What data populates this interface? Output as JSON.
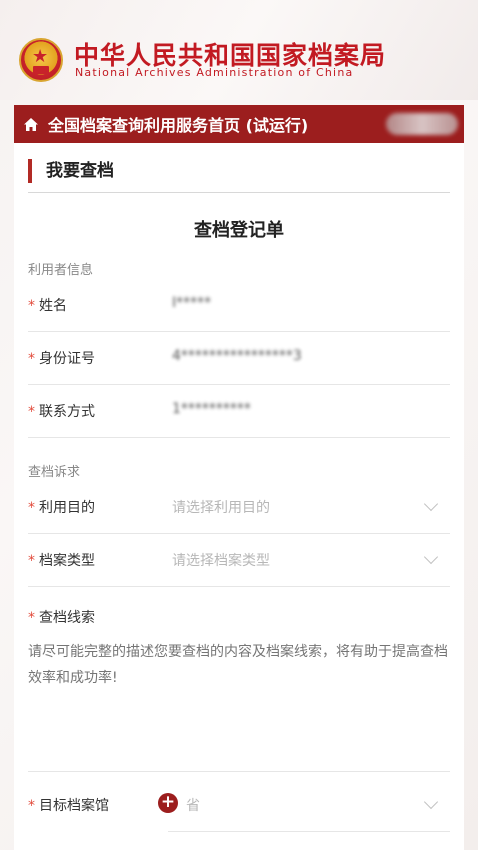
{
  "header": {
    "org_name_cn": "中华人民共和国国家档案局",
    "org_name_en": "National Archives Administration of China"
  },
  "nav": {
    "title": "全国档案查询利用服务首页 (试运行)"
  },
  "section": {
    "title": "我要查档"
  },
  "form": {
    "title": "查档登记单",
    "user_info_label": "利用者信息",
    "name": {
      "label": "姓名",
      "value": "I*****"
    },
    "id_number": {
      "label": "身份证号",
      "value": "4****************3"
    },
    "contact": {
      "label": "联系方式",
      "value": "1**********"
    },
    "request_label": "查档诉求",
    "purpose": {
      "label": "利用目的",
      "placeholder": "请选择利用目的"
    },
    "archive_type": {
      "label": "档案类型",
      "placeholder": "请选择档案类型"
    },
    "clue": {
      "label": "查档线索",
      "placeholder": "请尽可能完整的描述您要查档的内容及档案线索，将有助于提高查档效率和成功率!"
    },
    "target_archive": {
      "label": "目标档案馆",
      "province_placeholder": "省"
    },
    "required_mark": "*"
  },
  "colors": {
    "brand_red": "#c21a22",
    "nav_bg": "#9c1e1e",
    "required": "#e24b3b"
  },
  "icons": [
    "national-emblem-icon",
    "home-icon",
    "chevron-down-icon",
    "plus-circle-icon"
  ]
}
